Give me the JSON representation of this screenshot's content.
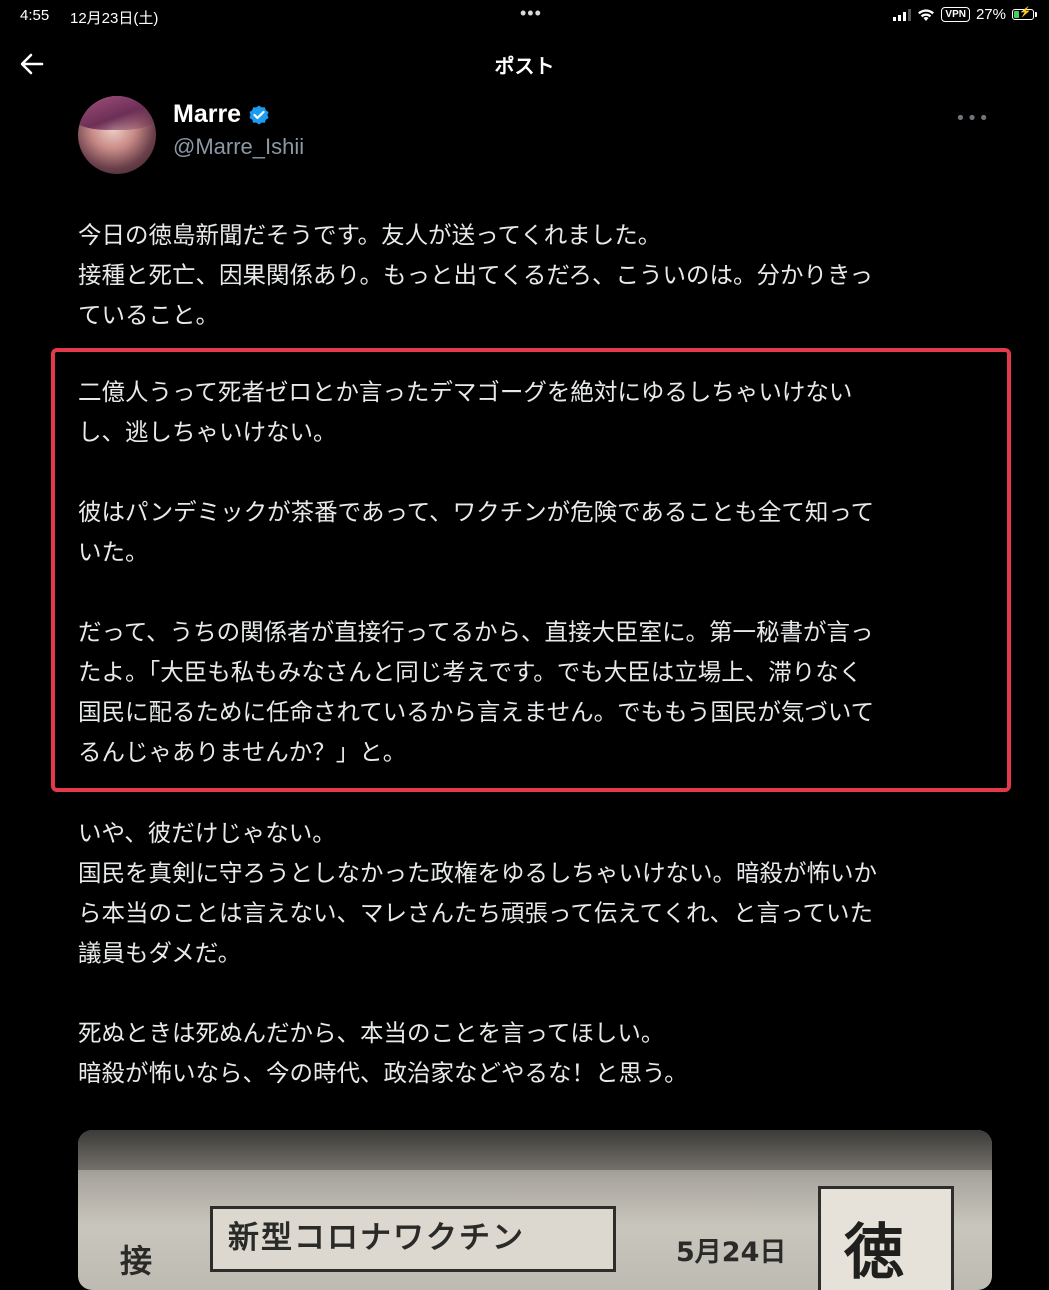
{
  "status_bar": {
    "time": "4:55",
    "date": "12月23日(土)",
    "dots": "•••",
    "vpn": "VPN",
    "battery": "27%"
  },
  "header": {
    "title": "ポスト",
    "back_icon": "arrow-left-icon"
  },
  "author": {
    "name": "Marre",
    "handle": "@Marre_Ishii",
    "verified_icon": "verified-badge-icon",
    "more_icon": "more-horizontal-icon",
    "more": "•••"
  },
  "post": {
    "paragraph_1": "今日の徳島新聞だそうです。友人が送ってくれました。\n接種と死亡、因果関係あり。もっと出てくるだろ、こういのは。分かりきっ\nていること。",
    "highlighted": "二億人うって死者ゼロとか言ったデマゴーグを絶対にゆるしちゃいけない\nし、逃しちゃいけない。\n\n彼はパンデミックが茶番であって、ワクチンが危険であることも全て知って\nいた。\n\nだって、うちの関係者が直接行ってるから、直接大臣室に。第一秘書が言っ\nたよ。「大臣も私もみなさんと同じ考えです。でも大臣は立場上、滞りなく\n国民に配るために任命されているから言えません。でももう国民が気づいて\nるんじゃありませんか？」と。",
    "paragraph_3": "いや、彼だけじゃない。\n国民を真剣に守ろうとしなかった政権をゆるしちゃいけない。暗殺が怖いか\nら本当のことは言えない、マレさんたち頑張って伝えてくれ、と言っていた\n議員もダメだ。\n\n死ぬときは死ぬんだから、本当のことを言ってほしい。\n暗殺が怖いなら、今の時代、政治家などやるな！と思う。",
    "highlight_color": "#e23a4a"
  },
  "media": {
    "headline": "新型コロナワクチン",
    "side_char": "接",
    "date": "5月24日",
    "masthead": "徳"
  }
}
